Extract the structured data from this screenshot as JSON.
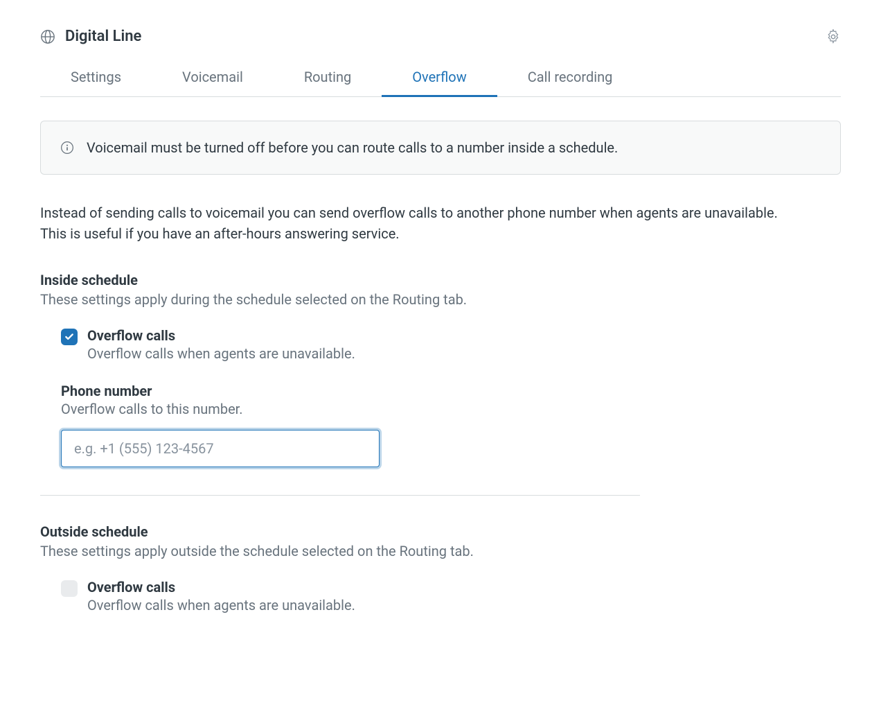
{
  "header": {
    "title": "Digital Line"
  },
  "tabs": [
    {
      "label": "Settings",
      "active": false
    },
    {
      "label": "Voicemail",
      "active": false
    },
    {
      "label": "Routing",
      "active": false
    },
    {
      "label": "Overflow",
      "active": true
    },
    {
      "label": "Call recording",
      "active": false
    }
  ],
  "banner": {
    "text": "Voicemail must be turned off before you can route calls to a number inside a schedule."
  },
  "description": "Instead of sending calls to voicemail you can send overflow calls to another phone number when agents are unavailable. This is useful if you have an after-hours answering service.",
  "inside": {
    "title": "Inside schedule",
    "subtitle": "These settings apply during the schedule selected on the Routing tab.",
    "overflow_label": "Overflow calls",
    "overflow_desc": "Overflow calls when agents are unavailable.",
    "phone_label": "Phone number",
    "phone_desc": "Overflow calls to this number.",
    "phone_placeholder": "e.g. +1 (555) 123-4567",
    "phone_value": ""
  },
  "outside": {
    "title": "Outside schedule",
    "subtitle": "These settings apply outside the schedule selected on the Routing tab.",
    "overflow_label": "Overflow calls",
    "overflow_desc": "Overflow calls when agents are unavailable."
  }
}
